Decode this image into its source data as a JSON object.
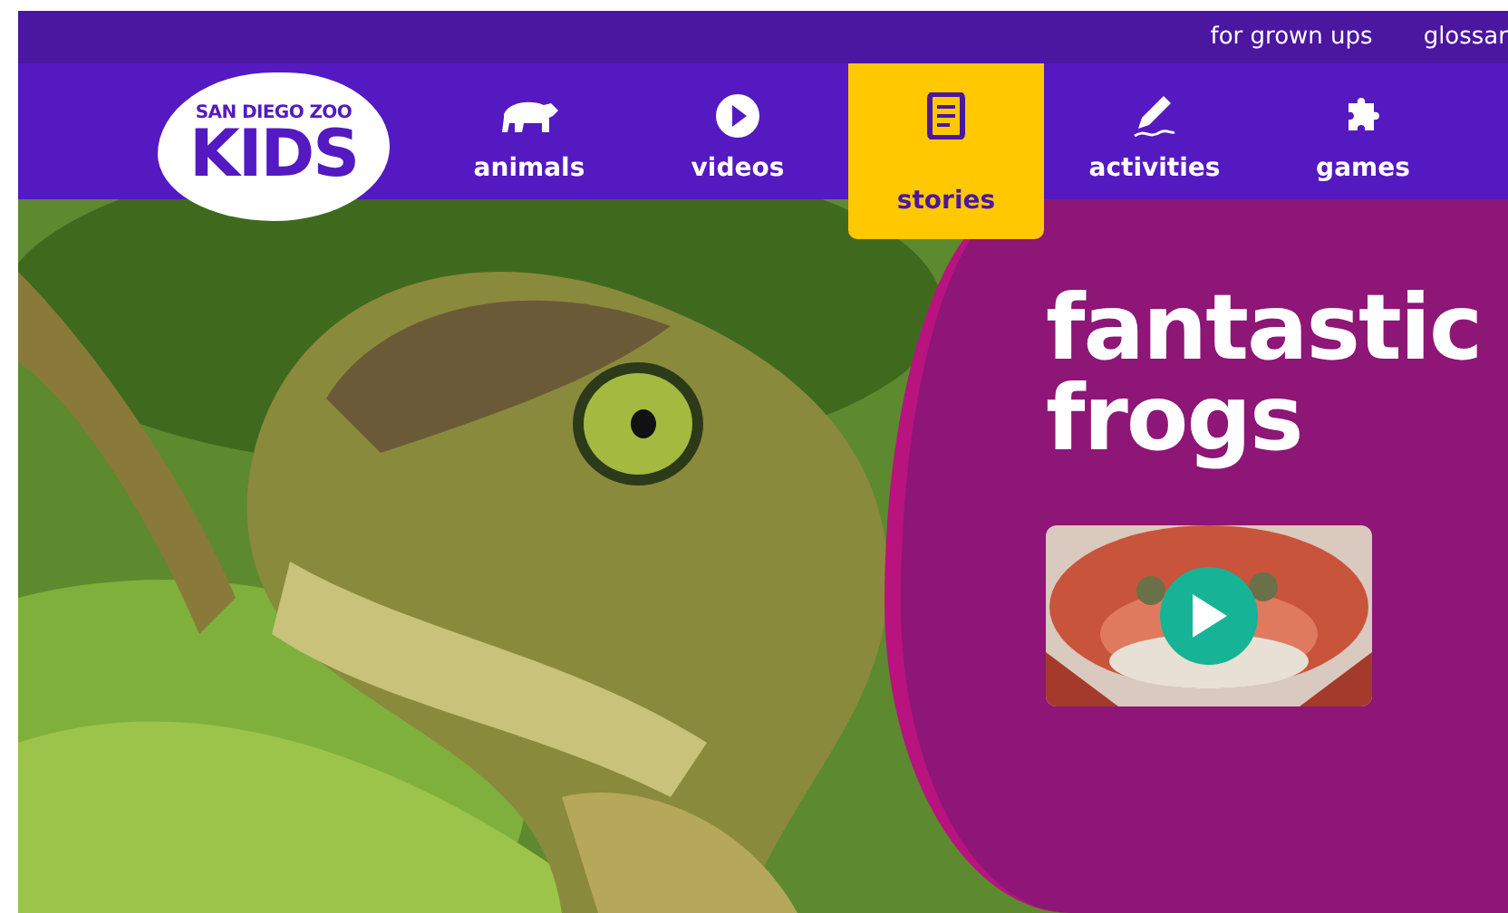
{
  "top_links": [
    {
      "label": "for grown ups"
    },
    {
      "label": "glossar"
    }
  ],
  "logo": {
    "line1": "SAN DIEGO ZOO",
    "line2": "KIDS"
  },
  "nav": [
    {
      "label": "animals",
      "selected": false
    },
    {
      "label": "videos",
      "selected": false
    },
    {
      "label": "stories",
      "selected": true
    },
    {
      "label": "activities",
      "selected": false
    },
    {
      "label": "games",
      "selected": false
    }
  ],
  "hero": {
    "kind": "picture",
    "title_lines": [
      "fantastic",
      "frogs"
    ]
  }
}
